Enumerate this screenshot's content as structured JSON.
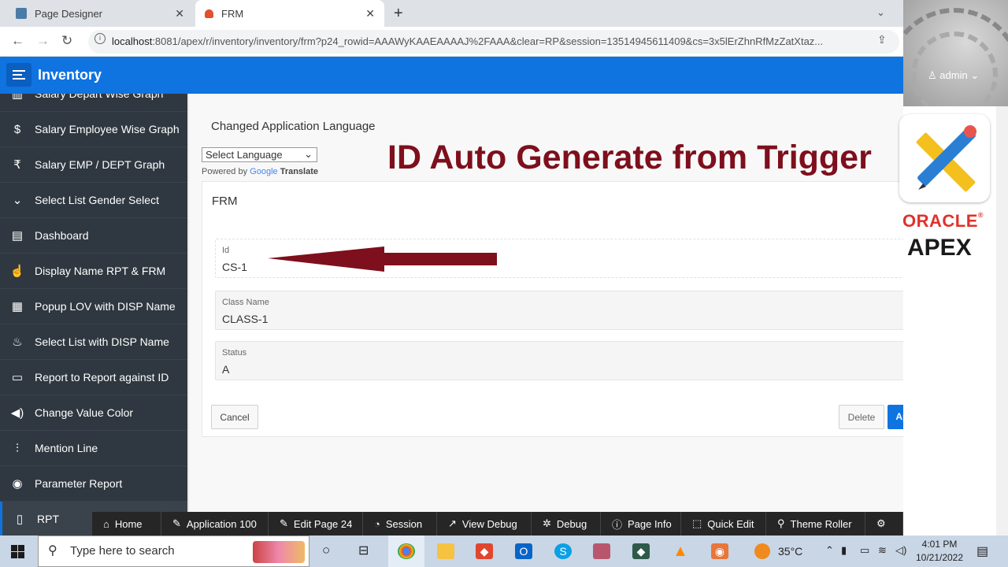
{
  "browser": {
    "tabs": [
      {
        "label": "Page Designer",
        "close": "✕"
      },
      {
        "label": "FRM",
        "close": "✕"
      }
    ],
    "new_tab": "+",
    "url_host": "localhost",
    "url_rest": ":8081/apex/r/inventory/inventory/frm?p24_rowid=AAAWyKAAEAAAAJ%2FAAA&clear=RP&session=13514945611409&cs=3x5lErZhnRfMzZatXtaz..."
  },
  "header": {
    "app_title": "Inventory",
    "user": "admin"
  },
  "sidebar": {
    "items": [
      {
        "label": "Salary Depart Wise Graph",
        "icon": "▥"
      },
      {
        "label": "Salary Employee Wise Graph",
        "icon": "$"
      },
      {
        "label": "Salary EMP / DEPT Graph",
        "icon": "₹"
      },
      {
        "label": "Select List Gender Select",
        "icon": "⌄"
      },
      {
        "label": "Dashboard",
        "icon": "▤"
      },
      {
        "label": "Display Name RPT & FRM",
        "icon": "☝"
      },
      {
        "label": "Popup LOV with DISP Name",
        "icon": "▦"
      },
      {
        "label": "Select List with DISP Name",
        "icon": "♨"
      },
      {
        "label": "Report to Report against ID",
        "icon": "▭"
      },
      {
        "label": "Change Value Color",
        "icon": "◀)"
      },
      {
        "label": "Mention Line",
        "icon": "⫶"
      },
      {
        "label": "Parameter Report",
        "icon": "◉"
      },
      {
        "label": "RPT",
        "icon": "▯"
      }
    ]
  },
  "translate": {
    "title": "Changed Application Language",
    "select_placeholder": "Select Language",
    "powered_by": "Powered by",
    "google": "Google",
    "translate": "Translate"
  },
  "banner": "ID Auto Generate from Trigger",
  "region": {
    "title": "FRM",
    "fields": [
      {
        "label": "Id",
        "value": "CS-1"
      },
      {
        "label": "Class Name",
        "value": "CLASS-1"
      },
      {
        "label": "Status",
        "value": "A"
      }
    ],
    "buttons": {
      "cancel": "Cancel",
      "delete": "Delete",
      "apply": "Apply Changes"
    }
  },
  "logos": {
    "oracle": "ORACLE",
    "registered": "®",
    "apex": "APEX"
  },
  "devbar": {
    "items": [
      {
        "label": "Home",
        "icon": "⌂"
      },
      {
        "label": "Application 100",
        "icon": "✎"
      },
      {
        "label": "Edit Page 24",
        "icon": "✎"
      },
      {
        "label": "Session",
        "icon": "◔"
      },
      {
        "label": "View Debug",
        "icon": "↗"
      },
      {
        "label": "Debug",
        "icon": "✲"
      },
      {
        "label": "Page Info",
        "icon": "ⓘ"
      },
      {
        "label": "Quick Edit",
        "icon": "⬚"
      },
      {
        "label": "Theme Roller",
        "icon": "⚲"
      },
      {
        "label": "",
        "icon": "⚙"
      }
    ]
  },
  "taskbar": {
    "search_placeholder": "Type here to search",
    "temperature": "35°C",
    "time": "4:01 PM",
    "date": "10/21/2022"
  },
  "colors": {
    "apex_blue": "#0f73e0",
    "banner_red": "#7e0f1c",
    "sidebar": "#2f3840",
    "arrow": "#7e0f1c"
  }
}
